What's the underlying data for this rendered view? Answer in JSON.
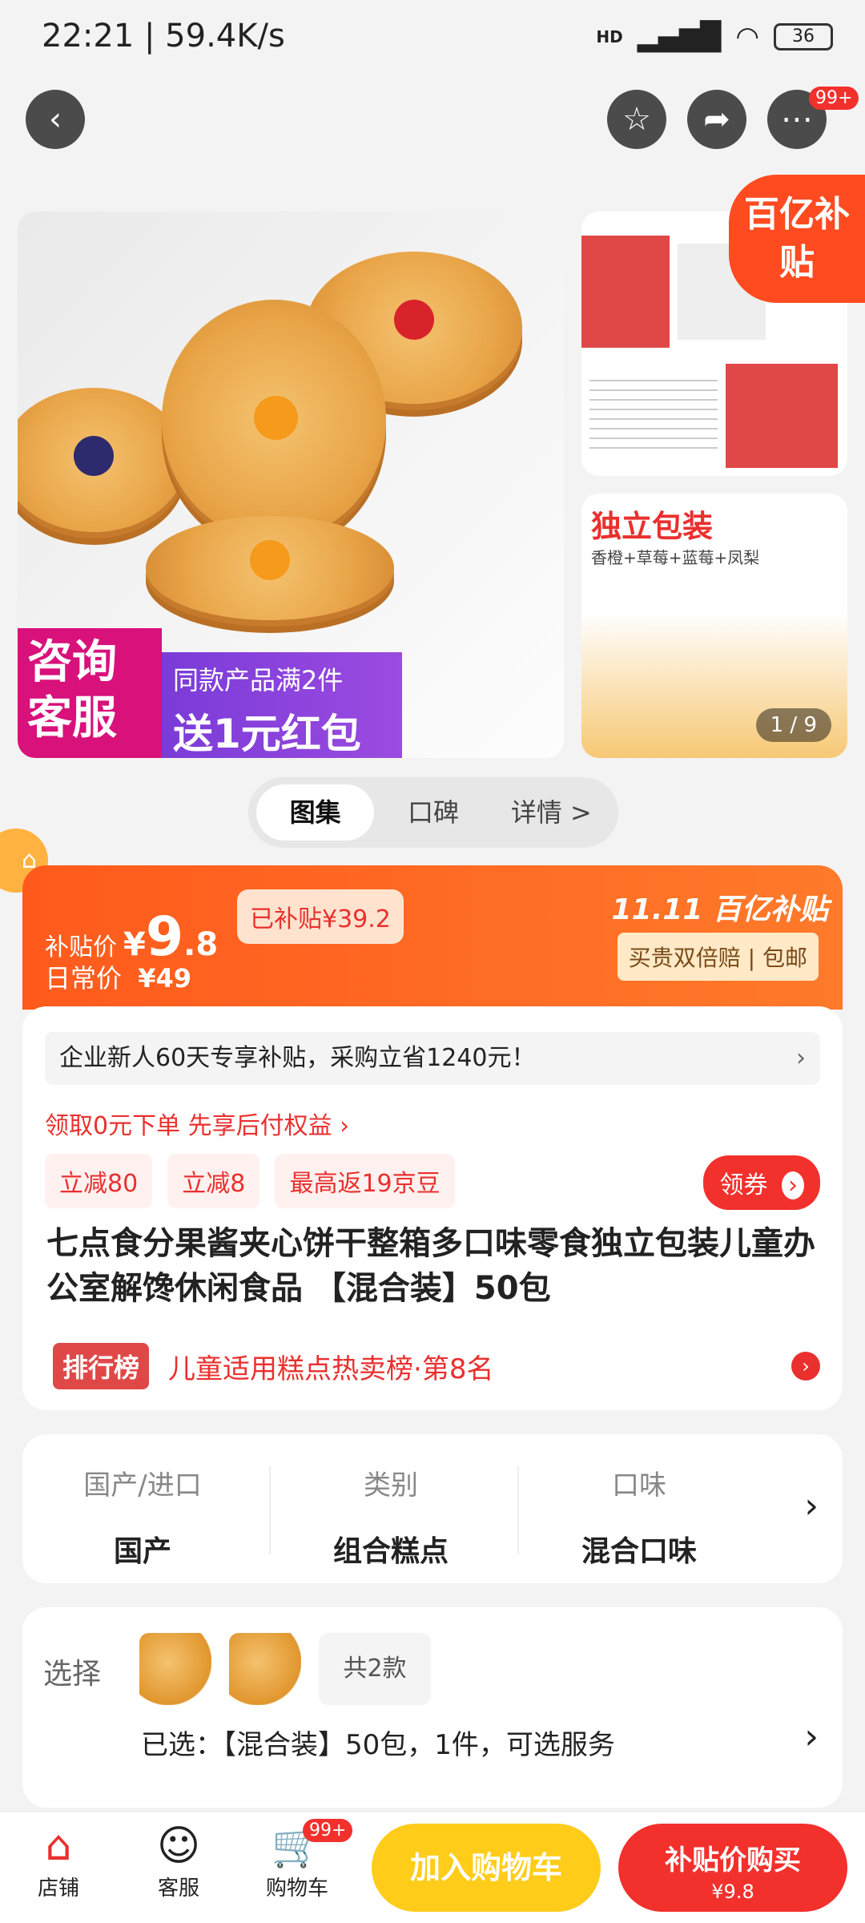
{
  "status": {
    "time": "22:21 | 59.4K/s",
    "network": "HD",
    "battery": "36"
  },
  "topnav": {
    "badge": "99+"
  },
  "gallery": {
    "promo_left": "咨询客服",
    "promo_right_top": "同款产品满2件",
    "promo_right_bottom": "送1元红包",
    "side2_title": "独立包装",
    "side2_sub": "香橙+草莓+蓝莓+凤梨",
    "counter": "1 / 9",
    "subsidy_tag": "百亿补贴"
  },
  "tabs": [
    {
      "label": "图集"
    },
    {
      "label": "口碑"
    },
    {
      "label": "详情 >"
    }
  ],
  "price": {
    "label": "补贴价",
    "symbol": "¥",
    "int": "9",
    "dec": ".8",
    "subsidized": "已补贴¥39.2",
    "daily_label": "日常价",
    "daily_value": "¥49",
    "event": "11.11 百亿补贴",
    "guarantee": "买贵双倍赔 | 包邮"
  },
  "promo": {
    "newuser": "企业新人60天专享补贴，采购立省1240元！",
    "credit": "领取0元下单 先享后付权益",
    "chips": [
      "立减80",
      "立减8",
      "最高返19京豆"
    ],
    "coupon": "领券"
  },
  "product": {
    "title": "七点食分果酱夹心饼干整箱多口味零食独立包装儿童办公室解馋休闲食品 【混合装】50包",
    "rank_badge": "排行榜",
    "rank_text": "儿童适用糕点热卖榜·第8名"
  },
  "specs": [
    {
      "key": "国产/进口",
      "value": "国产"
    },
    {
      "key": "类别",
      "value": "组合糕点"
    },
    {
      "key": "口味",
      "value": "混合口味"
    }
  ],
  "select": {
    "label": "选择",
    "count": "共2款",
    "selected": "已选：【混合装】50包，1件，可选服务"
  },
  "bottom": {
    "store": "店铺",
    "service": "客服",
    "cart": "购物车",
    "cart_badge": "99+",
    "add_cart": "加入购物车",
    "buy": "补贴价购买",
    "buy_price": "¥9.8"
  },
  "colors": {
    "accent": "#f2302c",
    "orange": "#ff5a1c",
    "yellow": "#ffcc1a"
  }
}
